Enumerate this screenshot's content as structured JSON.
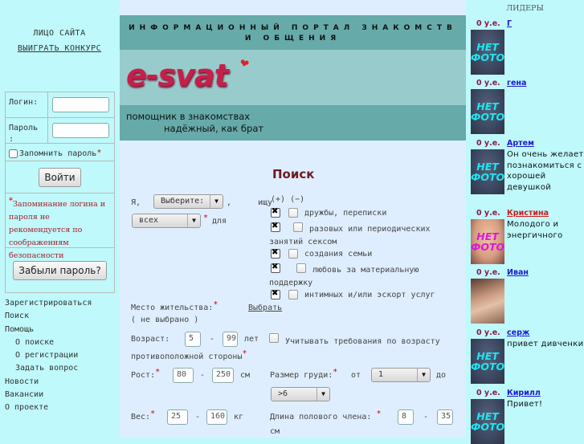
{
  "left": {
    "face_title": "ЛИЦО САЙТА",
    "contest_link": "ВЫИГРАТЬ КОНКУРС",
    "login": {
      "login_label": "Логин:",
      "login_value": "",
      "password_label": "Пароль :",
      "password_value": "",
      "remember_label": "Запомнить пароль",
      "remember_checked": false,
      "submit_label": "Войти",
      "warning": "Запоминание логина и пароля не рекомендуется по соображениям безопасности",
      "forgot_label": "Забыли пароль?"
    },
    "nav": [
      {
        "label": "Зарегистрироваться"
      },
      {
        "label": "Поиск"
      },
      {
        "label": "Помощь"
      },
      {
        "label": "О поиске",
        "sub": true
      },
      {
        "label": "О регистрации",
        "sub": true
      },
      {
        "label": "Задать вопрос",
        "sub": true
      },
      {
        "label": "Новости"
      },
      {
        "label": "Вакансии"
      },
      {
        "label": "О проекте"
      }
    ]
  },
  "header": {
    "portal_title": "ИНФОРМАЦИОННЫЙ ПОРТАЛ ЗНАКОМСТВ И ОБЩЕНИЯ",
    "logo": "e-svat",
    "tagline_1": "помощник в знакомствах",
    "tagline_2": "надёжный, как брат"
  },
  "search": {
    "title": "Поиск",
    "i_label": "Я,",
    "gender_select": "Выберите:",
    "seek_label": "ищу",
    "target_select": "всех",
    "for_label": "для",
    "plus_minus": "(+)  (−)",
    "goals": [
      {
        "label": "дружбы, переписки",
        "plus": true,
        "minus": false
      },
      {
        "label": "разовых или периодических занятий сексом",
        "plus": true,
        "minus": false
      },
      {
        "label": "создания семьи",
        "plus": true,
        "minus": false
      },
      {
        "label": "любовь за материальную поддержку",
        "plus": true,
        "minus": false
      },
      {
        "label": "интимных и/или эскорт услуг",
        "plus": true,
        "minus": false
      }
    ],
    "residence_label": "Место жительства:",
    "residence_link": "Выбрать",
    "residence_value": "( не выбрано )",
    "age_label": "Возраст:",
    "age_from": "5",
    "age_to": "99",
    "age_unit": "лет",
    "age_consider_label": "Учитывать требования по возрасту противоположной стороны",
    "age_consider_checked": false,
    "height_label": "Рост:",
    "height_from": "80",
    "height_to": "250",
    "height_unit": "см",
    "breast_label": "Размер груди:",
    "breast_from_label": "от",
    "breast_from": "1",
    "breast_to_label": "до",
    "breast_to": ">6",
    "weight_label": "Вес:",
    "weight_from": "25",
    "weight_to": "160",
    "weight_unit": "кг",
    "length_label": "Длина полового члена:",
    "length_from": "8",
    "length_to": "35",
    "length_unit": "см",
    "dash": "-"
  },
  "leaders": {
    "title": "ЛИДЕРЫ",
    "no_photo": "НЕТ ФОТО",
    "items": [
      {
        "price": "0 у.е.",
        "name": "Г",
        "desc": "",
        "photo": "no-photo"
      },
      {
        "price": "0 у.е.",
        "name": "гена",
        "desc": "",
        "photo": "no-photo"
      },
      {
        "price": "0 у.е.",
        "name": "Артем",
        "desc": "Он очень желает познакомиться с хорошей девушкой",
        "photo": "no-photo"
      },
      {
        "price": "0 у.е.",
        "name": "Кристина",
        "desc": "Молодого и энергичного",
        "photo": "no-photo-female"
      },
      {
        "price": "0 у.е.",
        "name": "Иван",
        "desc": "",
        "photo": "user-photo"
      },
      {
        "price": "0 у.е.",
        "name": "серж",
        "desc": "привет дивченки",
        "photo": "no-photo"
      },
      {
        "price": "0 у.е.",
        "name": "Кирилл",
        "desc": "Привет!",
        "photo": "no-photo"
      }
    ]
  }
}
